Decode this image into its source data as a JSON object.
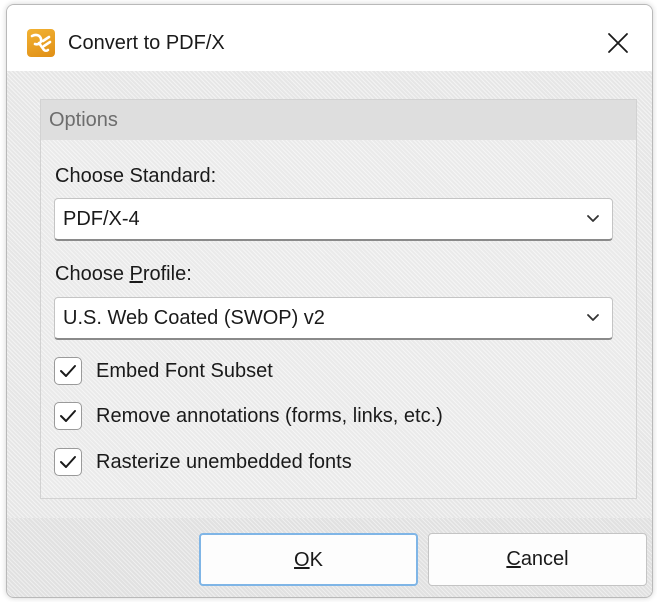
{
  "window": {
    "title": "Convert to PDF/X",
    "app_icon": "pdf-xchange-icon",
    "close_icon": "close-icon"
  },
  "options": {
    "group_title": "Options",
    "standard_label": "Choose Standard:",
    "standard_value": "PDF/X-4",
    "profile_label_pre": "Choose ",
    "profile_label_key": "P",
    "profile_label_post": "rofile:",
    "profile_value": "U.S. Web Coated (SWOP) v2",
    "checkboxes": [
      {
        "label": "Embed Font Subset",
        "checked": true
      },
      {
        "label": "Remove annotations (forms, links, etc.)",
        "checked": true
      },
      {
        "label": "Rasterize unembedded fonts",
        "checked": true
      }
    ]
  },
  "buttons": {
    "ok_key": "O",
    "ok_rest": "K",
    "cancel_key": "C",
    "cancel_rest": "ancel"
  },
  "colors": {
    "accent": "#7fb5e6",
    "check": "#1a1a1a",
    "app_icon": "#e89a1d"
  }
}
